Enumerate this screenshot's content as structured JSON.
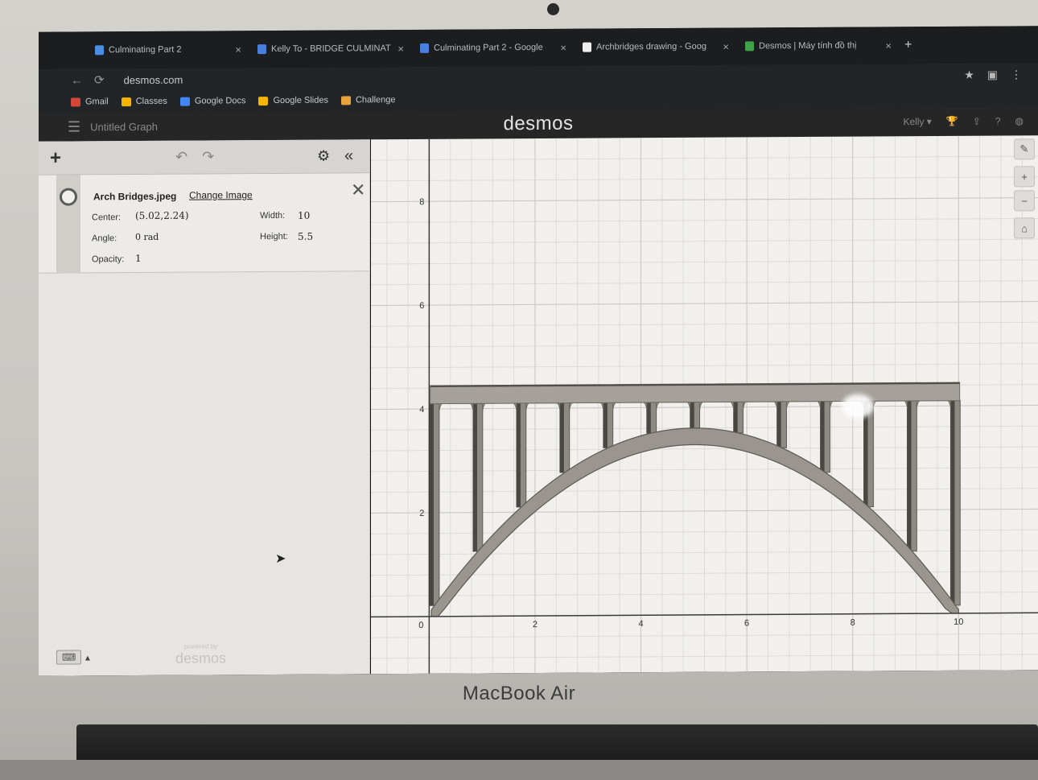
{
  "browser": {
    "tabs": [
      {
        "label": "Culminating Part 2",
        "color": "#4a90e2"
      },
      {
        "label": "Kelly To - BRIDGE CULMINAT",
        "color": "#4a7fe0"
      },
      {
        "label": "Culminating Part 2 - Google",
        "color": "#4a7fe0"
      },
      {
        "label": "Archbridges drawing - Goog",
        "color": "#eeeeee"
      },
      {
        "label": "Desmos | Máy tính đồ thị",
        "color": "#3fa34d"
      }
    ],
    "close_glyph": "×",
    "new_tab_glyph": "+",
    "url": "desmos.com",
    "bookmarks": [
      {
        "label": "Gmail",
        "color": "#d44638"
      },
      {
        "label": "Classes",
        "color": "#f4b400"
      },
      {
        "label": "Google Docs",
        "color": "#4285f4"
      },
      {
        "label": "Google Slides",
        "color": "#f4b400"
      },
      {
        "label": "Challenge",
        "color": "#e8a33d"
      }
    ]
  },
  "desmos": {
    "graph_title": "Untitled Graph",
    "logo": "desmos",
    "user": "Kelly"
  },
  "expression": {
    "image_name": "Arch Bridges.jpeg",
    "change_image": "Change Image",
    "center_label": "Center:",
    "center_value": "(5.02,2.24)",
    "width_label": "Width:",
    "width_value": "10",
    "angle_label": "Angle:",
    "angle_value": "0 rad",
    "height_label": "Height:",
    "height_value": "5.5",
    "opacity_label": "Opacity:",
    "opacity_value": "1"
  },
  "footer": {
    "powered_small": "powered by",
    "powered_big": "desmos"
  },
  "graph": {
    "x_ticks": [
      "0",
      "2",
      "4",
      "6",
      "8",
      "10"
    ],
    "y_ticks": [
      "2",
      "4",
      "6",
      "8"
    ],
    "xlim": [
      -1.1,
      11.5
    ],
    "ylim": [
      -1.1,
      9.2
    ],
    "grid": true
  },
  "laptop": {
    "model": "MacBook Air"
  }
}
